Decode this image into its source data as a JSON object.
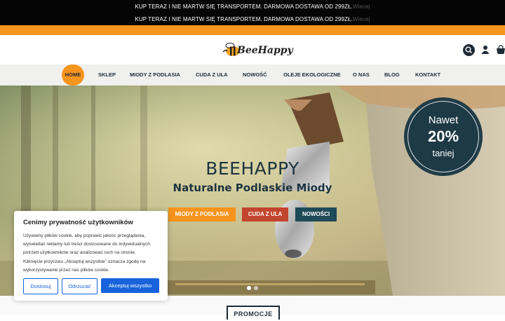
{
  "topbar": {
    "line1": "KUP TERAZ I NIE MARTW SIĘ TRANSPORTEM. DARMOWA DOSTAWA OD 299ZŁ.",
    "line1_fade": "Wiecej",
    "line2": "KUP TERAZ I NIE MARTW SIĘ TRANSPORTEM. DARMOWA DOSTAWA OD 299ZŁ.",
    "line2_fade": "Wiecej"
  },
  "header": {
    "logo_text": "BeeHappy",
    "search_icon": "search-icon",
    "user_icon": "user-icon",
    "cart_icon": "cart-icon"
  },
  "nav": {
    "items": [
      "HOME",
      "SKLEP",
      "MIODY Z PODLASIA",
      "CUDA Z ULA",
      "NOWOŚĆ",
      "OLEJE EKOLOGICZNE",
      "O NAS",
      "BLOG",
      "KONTAKT"
    ],
    "active_index": 0
  },
  "hero": {
    "title": "BEEHAPPY",
    "subtitle": "Naturalne Podlaskie Miody",
    "buttons": [
      {
        "label": "MIODY Z PODLASIA",
        "color": "#f7941d"
      },
      {
        "label": "CUDA Z ULA",
        "color": "#c2452d"
      },
      {
        "label": "NOWOŚCI",
        "color": "#1f4a57"
      }
    ],
    "badge": {
      "line1": "Nawet",
      "line2": "20%",
      "line3": "taniej"
    }
  },
  "promo": {
    "label": "PROMOCJE"
  },
  "cookie": {
    "title": "Cenimy prywatność użytkowników",
    "lines": [
      "Używamy plików cookie, aby poprawić jakość przeglądania,",
      "wyświetlać reklamy lub treści dostosowane do indywidualnych",
      "potrzeb użytkowników oraz analizować ruch na stronie.",
      "Kliknięcie przycisku „Akceptuj wszystkie\" oznacza zgodę na",
      "wykorzystywanie przez nas plików cookie."
    ],
    "btn_customize": "Dostosuj",
    "btn_reject": "Odrzucać",
    "btn_accept": "Akceptuj wszystko"
  },
  "colors": {
    "accent": "#f7941d",
    "navy": "#1d3a45",
    "cookie_blue": "#1863dc"
  }
}
